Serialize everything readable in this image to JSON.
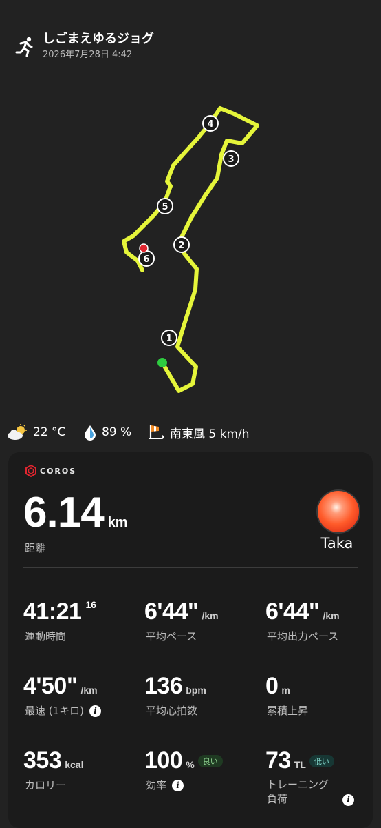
{
  "activity": {
    "title": "しごまえゆるジョグ",
    "datetime": "2026年7月28日 4:42"
  },
  "map": {
    "route_color": "#e5f53a",
    "start_color": "#2ecc40",
    "end_color": "#e0252f",
    "markers": [
      "1",
      "2",
      "3",
      "4",
      "5",
      "6"
    ]
  },
  "weather": {
    "temperature": "22 °C",
    "humidity": "89 %",
    "wind": "南東風 5 km/h"
  },
  "brand": "COROS",
  "summary": {
    "distance_value": "6.14",
    "distance_unit": "km",
    "distance_label": "距離",
    "user_name": "Taka"
  },
  "stats": [
    {
      "value": "41:21",
      "sup": "16",
      "label": "運動時間"
    },
    {
      "value": "6'44\"",
      "unit": "/km",
      "label": "平均ペース"
    },
    {
      "value": "6'44\"",
      "unit": "/km",
      "label": "平均出力ペース"
    },
    {
      "value": "4'50\"",
      "unit": "/km",
      "label": "最速 (1キロ)"
    },
    {
      "value": "136",
      "unit": "bpm",
      "label": "平均心拍数"
    },
    {
      "value": "0",
      "unit": "m",
      "label": "累積上昇"
    },
    {
      "value": "353",
      "unit": "kcal",
      "label": "カロリー"
    },
    {
      "value": "100",
      "unit": "%",
      "tag": "良い",
      "label": "効率"
    },
    {
      "value": "73",
      "unit": "TL",
      "tag": "低い",
      "label_line1": "トレーニング",
      "label_line2": "負荷"
    }
  ]
}
